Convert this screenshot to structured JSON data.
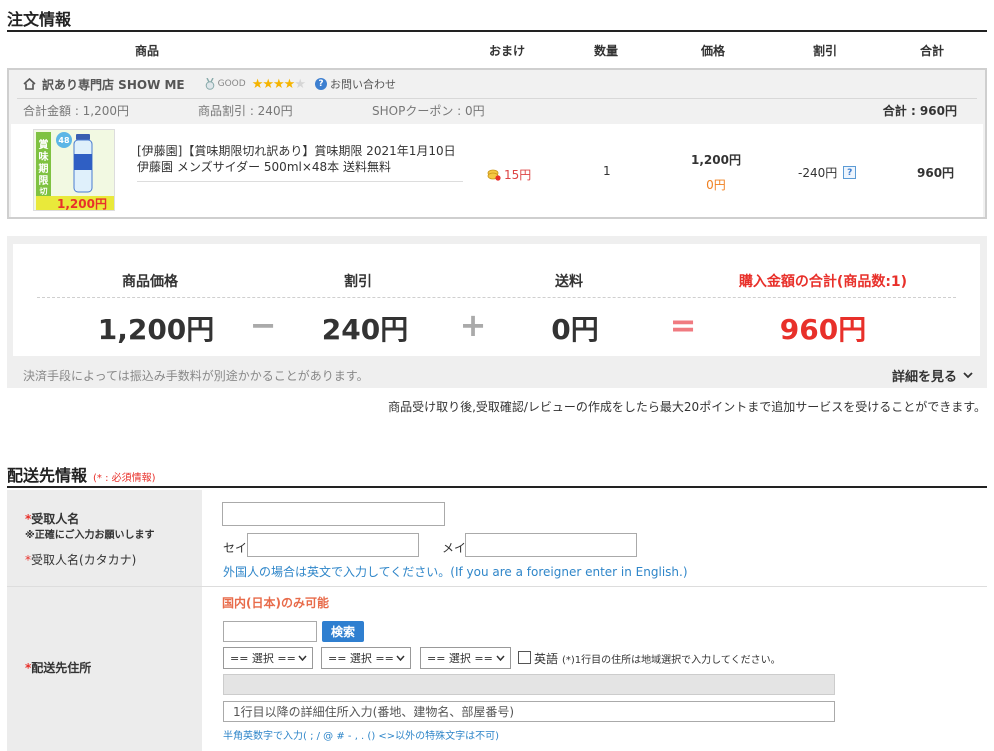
{
  "order": {
    "title": "注文情報",
    "columns": [
      "商品",
      "おまけ",
      "数量",
      "価格",
      "割引",
      "合計"
    ],
    "shop": {
      "name": "訳あり専門店 SHOW ME",
      "grade": "GOOD",
      "rating_stars": 4.5,
      "inquiry": "お問い合わせ",
      "total_amount": "合計金額 : 1,200円",
      "product_discount": "商品割引 : 240円",
      "shop_coupon": "SHOPクーポン : 0円",
      "total": "合計 : 960円"
    },
    "item": {
      "thumb_badge_top": "48本",
      "thumb_text": "賞味期限切れ",
      "thumb_price": "1,200円",
      "title": "[伊藤園]【賞味期限切れ訳あり】賞味期限 2021年1月10日 伊藤園 メンズサイダー 500ml×48本 送料無料",
      "bonus": "15円",
      "quantity": "1",
      "price": "1,200円",
      "price_sub": "0円",
      "discount": "-240円",
      "discount_help": "?",
      "line_total": "960円"
    }
  },
  "summary": {
    "labels": {
      "item_price": "商品価格",
      "discount": "割引",
      "shipping": "送料",
      "grand_total": "購入金額の合計(商品数:1)"
    },
    "values": {
      "item_price": "1,200円",
      "discount": "240円",
      "shipping": "0円",
      "grand_total": "960円"
    },
    "operators": {
      "minus": "−",
      "plus": "+",
      "equals": "="
    },
    "fee_note": "決済手段によっては振込み手数料が別途かかることがあります。",
    "detail_link": "詳細を見る",
    "point_note": "商品受け取り後,受取確認/レビューの作成をしたら最大20ポイントまで追加サービスを受けることができます。"
  },
  "shipping": {
    "title": "配送先情報",
    "required_note": "(* : 必須情報)",
    "recipient_label": "受取人名",
    "recipient_sub": "※正確にご入力お願いします",
    "kana_label": "受取人名(カタカナ)",
    "sei_label": "セイ",
    "mei_label": "メイ",
    "foreigner_note": "外国人の場合は英文で入力してください。(If you are a foreigner enter in English.)",
    "address_label": "配送先住所",
    "domestic_only": "国内(日本)のみ可能",
    "search_button": "検索",
    "select_placeholder": "== 選択 ==",
    "english_label": "英語",
    "english_note": "(*)1行目の住所は地域選択で入力してください。",
    "detail_placeholder": "1行目以降の詳細住所入力(番地、建物名、部屋番号)",
    "charset_note": "半角英数字で入力( ; / @ # - , . () <>以外の特殊文字は不可)"
  },
  "colors": {
    "accent_red": "#e8302a",
    "link_blue": "#2f86c9",
    "star": "#f5b400"
  },
  "icons": [
    "home-icon",
    "medal-icon",
    "star-icon",
    "question-icon",
    "coin-icon",
    "chevron-down-icon",
    "caret-down-icon"
  ]
}
